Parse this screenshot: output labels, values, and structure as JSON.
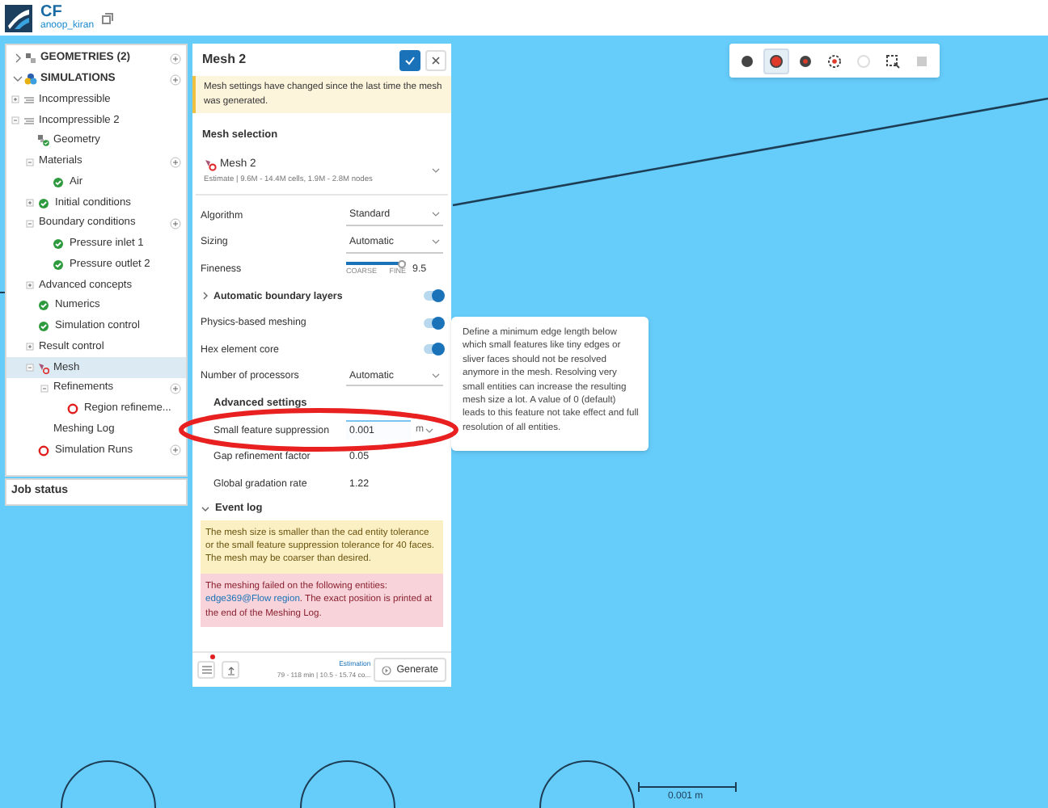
{
  "header": {
    "app": "CF",
    "user": "anoop_kiran"
  },
  "tree": [
    {
      "label": "GEOMETRIES (2)",
      "kind": "category",
      "expanded": false,
      "has_add": true
    },
    {
      "label": "SIMULATIONS",
      "kind": "category",
      "expanded": true,
      "has_add": true,
      "children": [
        {
          "label": "Incompressible",
          "kind": "simulation",
          "expanded": false,
          "selected": false
        },
        {
          "label": "Incompressible 2",
          "kind": "simulation",
          "expanded": true,
          "selected": false,
          "children": [
            {
              "label": "Geometry",
              "kind": "geometry",
              "error": false,
              "selected": false
            },
            {
              "label": "Materials",
              "expanded": true,
              "has_add": true,
              "selected": false,
              "children": [
                {
                  "label": "Air",
                  "error": false,
                  "selected": false
                }
              ]
            },
            {
              "label": "Initial conditions",
              "error": false,
              "expanded": false,
              "selected": false
            },
            {
              "label": "Boundary conditions",
              "expanded": true,
              "has_add": true,
              "selected": false,
              "children": [
                {
                  "label": "Pressure inlet 1",
                  "error": false,
                  "selected": false
                },
                {
                  "label": "Pressure outlet 2",
                  "error": false,
                  "selected": false
                }
              ]
            },
            {
              "label": "Advanced concepts",
              "expanded": false,
              "selected": false
            },
            {
              "label": "Numerics",
              "error": false,
              "selected": false
            },
            {
              "label": "Simulation control",
              "error": false,
              "selected": false
            },
            {
              "label": "Result control",
              "expanded": false,
              "selected": false
            },
            {
              "label": "Mesh",
              "kind": "mesh",
              "error": true,
              "expanded": true,
              "selected": true,
              "children": [
                {
                  "label": "Refinements",
                  "expanded": true,
                  "has_add": true,
                  "selected": false,
                  "children": [
                    {
                      "label": "Region refineme...",
                      "error": true,
                      "selected": false
                    }
                  ]
                },
                {
                  "label": "Meshing Log",
                  "selected": false
                }
              ]
            },
            {
              "label": "Simulation Runs",
              "error": true,
              "has_add": true,
              "selected": false
            }
          ]
        }
      ]
    }
  ],
  "job_status": "Job status",
  "panel": {
    "title": "Mesh 2",
    "notice": "Mesh settings have changed since the last time the mesh was generated.",
    "selection_label": "Mesh selection",
    "mesh_name": "Mesh 2",
    "mesh_estimate": "Estimate | 9.6M - 14.4M cells, 1.9M - 2.8M nodes",
    "fields": [
      {
        "kind": "select",
        "label": "Algorithm",
        "value": "Standard"
      },
      {
        "kind": "select",
        "label": "Sizing",
        "value": "Automatic"
      },
      {
        "kind": "slider",
        "label": "Fineness",
        "value": "9.5",
        "level": 0.92,
        "min_label": "COARSE",
        "max_label": "FINE"
      },
      {
        "kind": "toggle",
        "label": "Automatic boundary layers",
        "on": true,
        "collapsible": true
      },
      {
        "kind": "toggle",
        "label": "Physics-based meshing",
        "on": true
      },
      {
        "kind": "toggle",
        "label": "Hex element core",
        "on": true
      },
      {
        "kind": "select",
        "label": "Number of processors",
        "value": "Automatic"
      },
      {
        "kind": "heading",
        "label": "Advanced settings"
      },
      {
        "kind": "input",
        "label": "Small feature suppression",
        "value": "0.001",
        "unit": "m",
        "focused": true
      },
      {
        "kind": "input",
        "label": "Gap refinement factor",
        "value": "0.05",
        "focused": false
      },
      {
        "kind": "input",
        "label": "Global gradation rate",
        "value": "1.22",
        "focused": false
      }
    ],
    "event_log": {
      "label": "Event log",
      "expanded": true,
      "messages": [
        {
          "kind": "warning",
          "text": "The mesh size is smaller than the cad entity tolerance or the small feature suppression tolerance for 40 faces. The mesh may be coarser than desired."
        },
        {
          "kind": "error",
          "before": "The meshing failed on the following entities: ",
          "link": "edge369@Flow region",
          "after": ". The exact position is printed at the end of the Meshing Log."
        }
      ]
    },
    "estimation_label": "Estimation",
    "estimation": "79 - 118 min | 10.5 - 15.74 co...",
    "generate": "Generate"
  },
  "tooltip": "Define a minimum edge length below which small features like tiny edges or sliver faces should not be resolved anymore in the mesh. Resolving very small entities can increase the resulting mesh size a lot. A value of 0 (default) leads to this feature not take effect and full resolution of all entities.",
  "toolbar": [
    {
      "selected": false,
      "disabled": false
    },
    {
      "selected": true,
      "disabled": false
    },
    {
      "selected": false,
      "disabled": false
    },
    {
      "selected": false,
      "disabled": false
    },
    {
      "selected": false,
      "disabled": true
    },
    {
      "selected": false,
      "disabled": false
    },
    {
      "selected": false,
      "disabled": true
    }
  ],
  "scale_label": "0.001 m"
}
